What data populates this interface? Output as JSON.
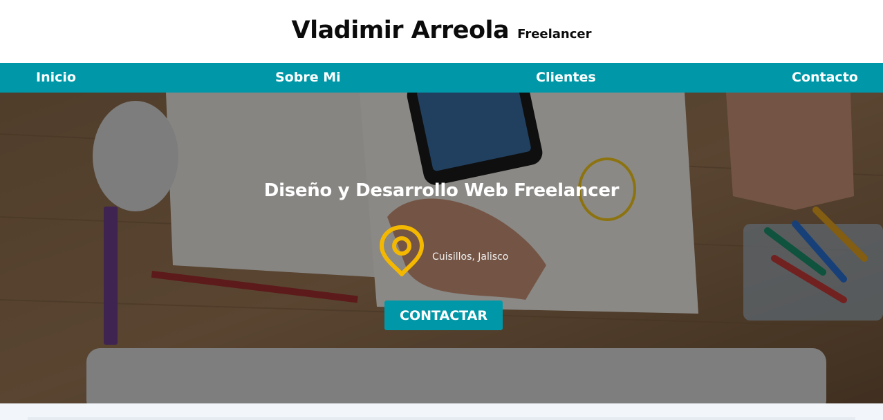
{
  "header": {
    "name": "Vladimir Arreola",
    "role": "Freelancer"
  },
  "nav": {
    "items": [
      {
        "label": "Inicio"
      },
      {
        "label": "Sobre Mi"
      },
      {
        "label": "Clientes"
      },
      {
        "label": "Contacto"
      }
    ]
  },
  "hero": {
    "title": "Diseño y Desarrollo Web Freelancer",
    "location": "Cuisillos, Jalisco",
    "location_icon": "map-pin-icon",
    "cta_label": "CONTACTAR"
  },
  "colors": {
    "accent": "#0098a8",
    "pin": "#f5b800",
    "text_dark": "#0b0b0b"
  }
}
